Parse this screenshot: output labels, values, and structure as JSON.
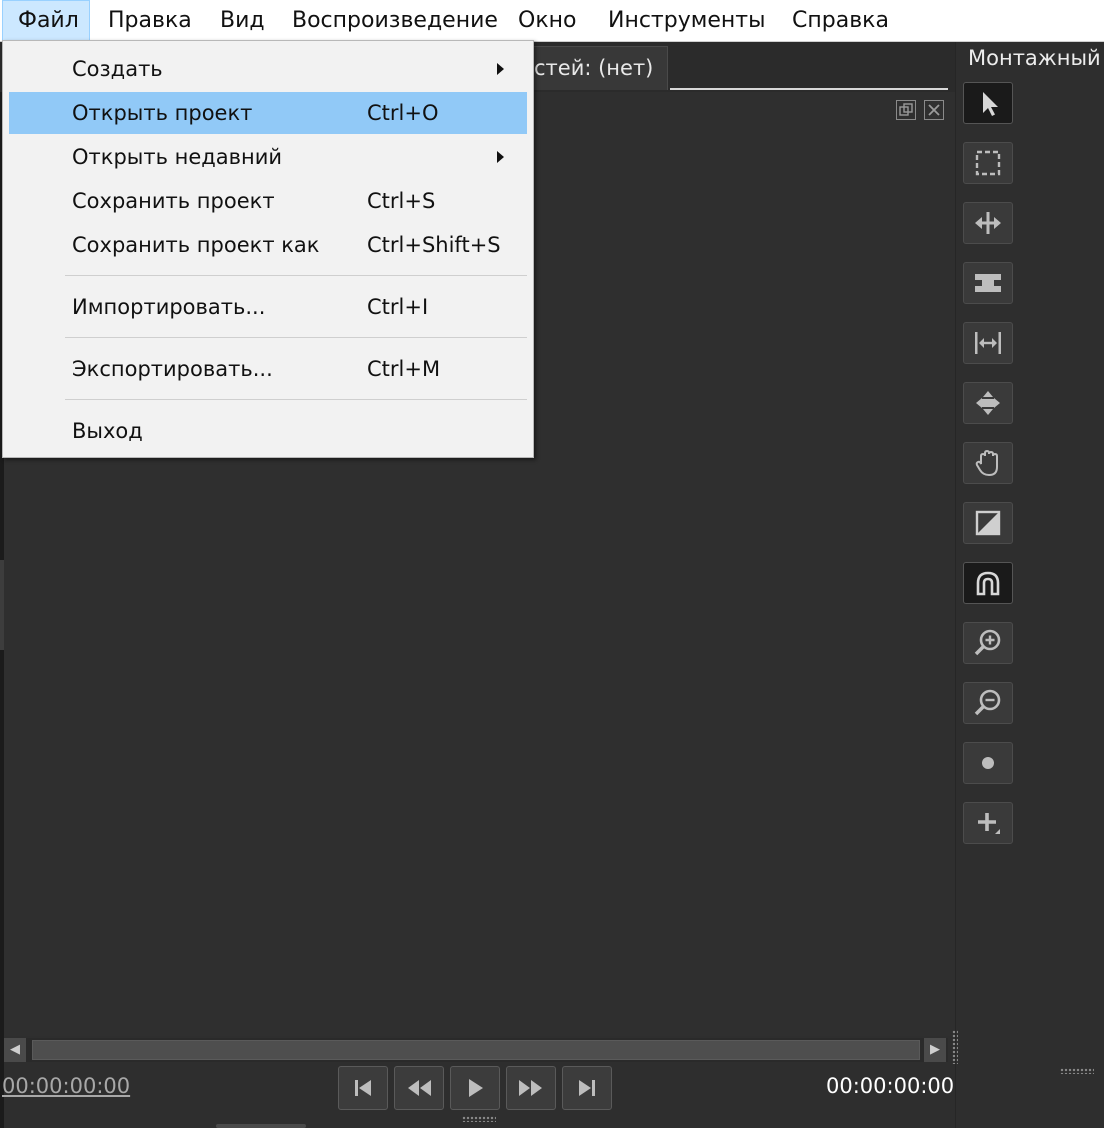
{
  "menubar": {
    "items": [
      {
        "label": "Файл",
        "active": true
      },
      {
        "label": "Правка"
      },
      {
        "label": "Вид"
      },
      {
        "label": "Воспроизведение"
      },
      {
        "label": "Окно"
      },
      {
        "label": "Инструменты"
      },
      {
        "label": "Справка"
      }
    ]
  },
  "file_menu": {
    "items": [
      {
        "label": "Создать",
        "shortcut": "",
        "submenu": true
      },
      {
        "label": "Открыть проект",
        "shortcut": "Ctrl+O",
        "highlighted": true
      },
      {
        "label": "Открыть недавний",
        "shortcut": "",
        "submenu": true
      },
      {
        "label": "Сохранить проект",
        "shortcut": "Ctrl+S"
      },
      {
        "label": "Сохранить проект как",
        "shortcut": "Ctrl+Shift+S"
      },
      {
        "label": "Импортировать...",
        "shortcut": "Ctrl+I"
      },
      {
        "label": "Экспортировать...",
        "shortcut": "Ctrl+M"
      },
      {
        "label": "Выход",
        "shortcut": ""
      }
    ]
  },
  "viewer": {
    "tab_label": "стей: (нет)",
    "panel_buttons": [
      "float-icon",
      "close-icon"
    ]
  },
  "workspace_mode": "Монтажный",
  "tools": [
    {
      "icon": "pointer-icon",
      "selected": true
    },
    {
      "icon": "marquee-select-icon"
    },
    {
      "icon": "ripple-edit-icon"
    },
    {
      "icon": "slip-icon"
    },
    {
      "icon": "stretch-icon"
    },
    {
      "icon": "move-icon"
    },
    {
      "icon": "hand-icon"
    },
    {
      "icon": "transition-icon"
    },
    {
      "icon": "snap-magnet-icon",
      "selected": true
    },
    {
      "icon": "zoom-in-icon"
    },
    {
      "icon": "zoom-out-icon"
    },
    {
      "icon": "center-playhead-icon"
    },
    {
      "icon": "add-marker-icon"
    }
  ],
  "transport": {
    "current_time": "00:00:00:00",
    "duration": "00:00:00:00",
    "buttons": [
      "jump-start-icon",
      "rewind-icon",
      "play-icon",
      "fast-forward-icon",
      "jump-end-icon"
    ]
  },
  "colors": {
    "menu_highlight": "#91c9f7",
    "menubar_active": "#cce8ff",
    "background": "#2e2e2e",
    "tool_bg": "#3a3a3a"
  }
}
